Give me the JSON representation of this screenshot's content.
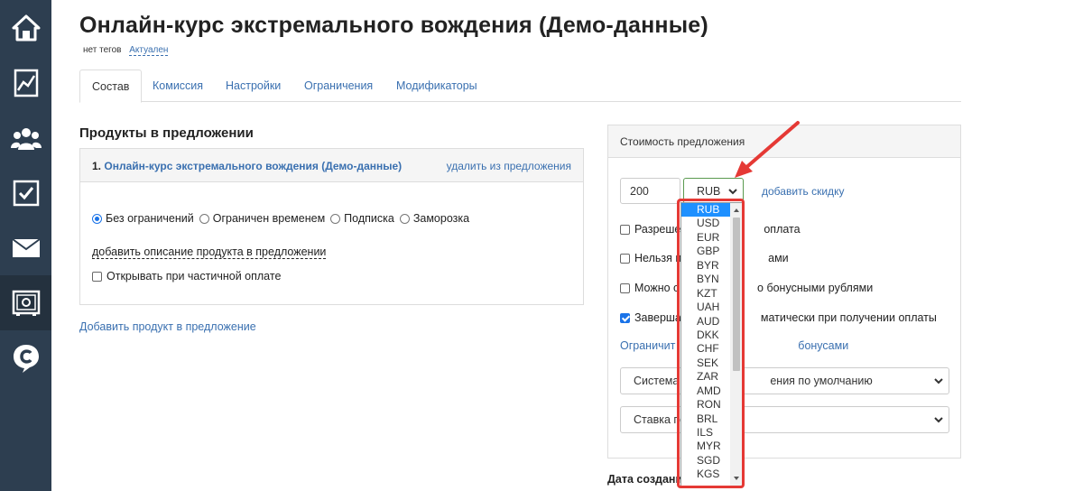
{
  "page": {
    "title": "Онлайн-курс экстремального вождения (Демо-данные)",
    "tags_label": "нет тегов",
    "status_link": "Актуален"
  },
  "tabs": [
    {
      "label": "Состав",
      "active": true
    },
    {
      "label": "Комиссия",
      "active": false
    },
    {
      "label": "Настройки",
      "active": false
    },
    {
      "label": "Ограничения",
      "active": false
    },
    {
      "label": "Модификаторы",
      "active": false
    }
  ],
  "products": {
    "heading": "Продукты в предложении",
    "item": {
      "number": "1.",
      "name": "Онлайн-курс экстремального вождения (Демо-данные)",
      "remove_label": "удалить из предложения",
      "access_options": [
        {
          "label": "Без ограничений",
          "checked": true
        },
        {
          "label": "Ограничен временем",
          "checked": false
        },
        {
          "label": "Подписка",
          "checked": false
        },
        {
          "label": "Заморозка",
          "checked": false
        }
      ],
      "description_link": "добавить описание продукта в предложении",
      "partial_payment_label": "Открывать при частичной оплате"
    },
    "add_product_link": "Добавить продукт в предложение"
  },
  "price": {
    "heading": "Стоимость предложения",
    "amount": "200",
    "currency": "RUB",
    "add_discount": "добавить скидку",
    "options": [
      {
        "label": "Разреше",
        "label_tail": "оплата",
        "checked": false
      },
      {
        "label": "Нельзя п",
        "label_tail": "ами",
        "checked": false
      },
      {
        "label": "Можно о",
        "label_tail": "о бонусными рублями",
        "checked": false
      },
      {
        "label": "Заверша",
        "label_tail": "матически при получении оплаты",
        "checked": true
      }
    ],
    "bonus_limit_link": "Ограничит",
    "bonus_limit_tail": "бонусами",
    "system_select": "Система",
    "system_select_tail": "ения по умолчанию",
    "rate_select": "Ставка по"
  },
  "date_label": "Дата создани",
  "currency_dropdown": {
    "selected": "RUB",
    "items": [
      "RUB",
      "USD",
      "EUR",
      "GBP",
      "BYR",
      "BYN",
      "KZT",
      "UAH",
      "AUD",
      "DKK",
      "CHF",
      "SEK",
      "ZAR",
      "AMD",
      "RON",
      "BRL",
      "ILS",
      "MYR",
      "SGD",
      "KGS"
    ]
  },
  "sidebar": {
    "items": [
      {
        "icon": "home-icon"
      },
      {
        "icon": "chart-icon"
      },
      {
        "icon": "users-icon"
      },
      {
        "icon": "checkbox-icon"
      },
      {
        "icon": "mail-icon"
      },
      {
        "icon": "safe-icon",
        "active": true
      },
      {
        "icon": "chat-c-icon"
      }
    ]
  },
  "colors": {
    "sidebar_bg": "#2d3e50",
    "link": "#3a70b0",
    "accent_red": "#e53935",
    "selected_blue": "#1e90ff"
  }
}
